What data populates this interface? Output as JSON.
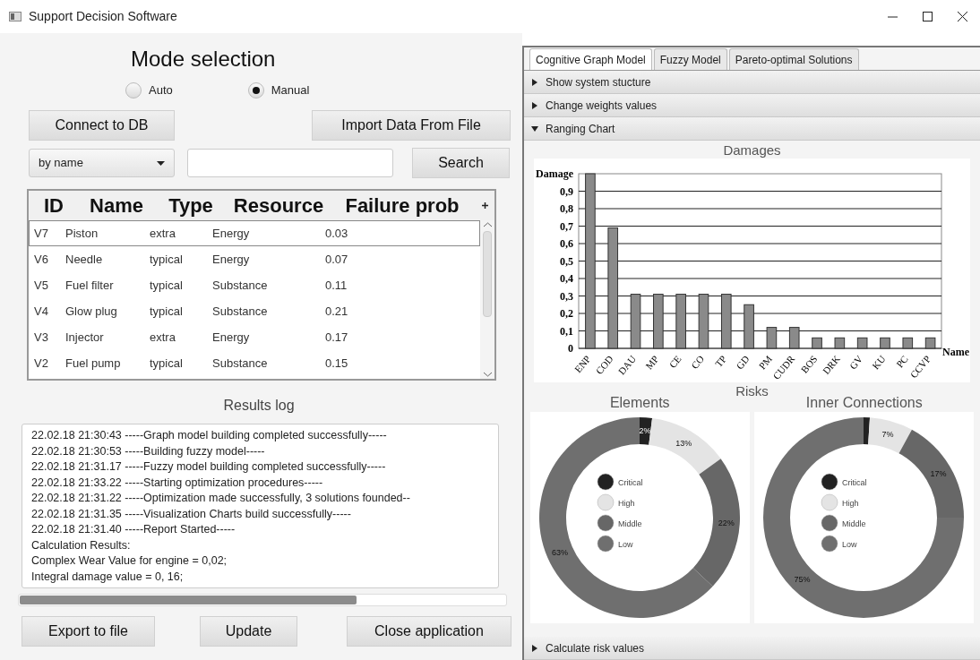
{
  "window": {
    "title": "Support Decision Software"
  },
  "mode": {
    "title": "Mode selection",
    "options": [
      {
        "label": "Auto",
        "selected": false
      },
      {
        "label": "Manual",
        "selected": true
      }
    ]
  },
  "top_buttons": [
    "Connect to DB",
    "Import Data From File"
  ],
  "search": {
    "filter": "by name",
    "button": "Search"
  },
  "table": {
    "columns": [
      "ID",
      "Name",
      "Type",
      "Resource",
      "Failure prob"
    ],
    "rows": [
      {
        "cells": [
          "V7",
          "Piston",
          "extra",
          "Energy",
          "0.03"
        ],
        "selected": true
      },
      {
        "cells": [
          "V6",
          "Needle",
          "typical",
          "Energy",
          "0.07"
        ],
        "selected": false
      },
      {
        "cells": [
          "V5",
          "Fuel filter",
          "typical",
          "Substance",
          "0.11"
        ],
        "selected": false
      },
      {
        "cells": [
          "V4",
          "Glow plug",
          "typical",
          "Substance",
          "0.21"
        ],
        "selected": false
      },
      {
        "cells": [
          "V3",
          "Injector",
          "extra",
          "Energy",
          "0.17"
        ],
        "selected": false
      },
      {
        "cells": [
          "V2",
          "Fuel pump",
          "typical",
          "Substance",
          "0.15"
        ],
        "selected": false
      }
    ]
  },
  "results_log": {
    "title": "Results log",
    "lines": [
      "22.02.18  21:30:43 -----Graph model building completed successfully-----",
      "22.02.18  21:30:53 -----Building fuzzy model-----",
      "22.02.18  21:31.17 -----Fuzzy model building completed successfully-----",
      "22.02.18  21:33.22 -----Starting optimization procedures-----",
      "22.02.18  21:31.22 -----Optimization made successfully, 3 solutions founded--",
      "22.02.18  21:31.35 -----Visualization Charts build successfully-----",
      "22.02.18  21:31.40 -----Report Started-----",
      "Calculation Results:",
      "Complex Wear Value for engine = 0,02;",
      "Integral damage value = 0, 16;"
    ]
  },
  "bottom_buttons": [
    "Export to file",
    "Update",
    "Close application"
  ],
  "tabs": [
    {
      "label": "Cognitive Graph Model",
      "selected": true
    },
    {
      "label": "Fuzzy Model",
      "selected": false
    },
    {
      "label": "Pareto-optimal Solutions",
      "selected": false
    }
  ],
  "sections": [
    {
      "title": "Show system stucture",
      "expanded": false
    },
    {
      "title": "Change weights values",
      "expanded": false
    },
    {
      "title": "Ranging Chart",
      "expanded": true,
      "content": {
        "damages": {
          "chart_data": {
            "type": "bar",
            "title": "Damages",
            "xlabel": "Name",
            "ylabel": "Damage",
            "categories": [
              "ENP",
              "COD",
              "DAU",
              "MP",
              "CE",
              "CO",
              "TP",
              "GD",
              "PM",
              "CUDR",
              "BOS",
              "DRK",
              "GV",
              "KU",
              "PC",
              "CCVP"
            ],
            "values": [
              1.0,
              0.69,
              0.31,
              0.31,
              0.31,
              0.31,
              0.31,
              0.25,
              0.12,
              0.12,
              0.06,
              0.06,
              0.06,
              0.06,
              0.06,
              0.06
            ],
            "ylim": [
              0,
              1
            ],
            "grid": true,
            "yticks": [
              {
                "value": 0,
                "label": "0"
              },
              {
                "value": 0.1,
                "label": "0,1"
              },
              {
                "value": 0.2,
                "label": "0,2"
              },
              {
                "value": 0.3,
                "label": "0,3"
              },
              {
                "value": 0.4,
                "label": "0,4"
              },
              {
                "value": 0.5,
                "label": "0,5"
              },
              {
                "value": 0.6,
                "label": "0,6"
              },
              {
                "value": 0.7,
                "label": "0,7"
              },
              {
                "value": 0.8,
                "label": "0,8"
              },
              {
                "value": 0.9,
                "label": "0,9"
              }
            ]
          }
        },
        "risks": {
          "title": "Risks",
          "charts": [
            {
              "chart_data": {
                "type": "donut",
                "title": "Elements",
                "categories": [
                  "Critical",
                  "High",
                  "Middle",
                  "Low"
                ],
                "colors": [
                  "#222222",
                  "#e4e4e4",
                  "#676767",
                  "#6f6f6f"
                ],
                "values": [
                  2,
                  13,
                  22,
                  63
                ],
                "value_labels": [
                  "2%",
                  "13%",
                  "22%",
                  "63%"
                ],
                "legend": true
              }
            },
            {
              "chart_data": {
                "type": "donut",
                "title": "Inner Connections",
                "categories": [
                  "Critical",
                  "High",
                  "Middle",
                  "Low"
                ],
                "colors": [
                  "#222222",
                  "#e4e4e4",
                  "#676767",
                  "#6f6f6f"
                ],
                "values": [
                  1,
                  7,
                  17,
                  75
                ],
                "value_labels": [
                  null,
                  "7%",
                  "17%",
                  "75%"
                ],
                "legend": true
              }
            }
          ]
        }
      }
    },
    {
      "title": "Calculate risk values",
      "expanded": false
    }
  ]
}
